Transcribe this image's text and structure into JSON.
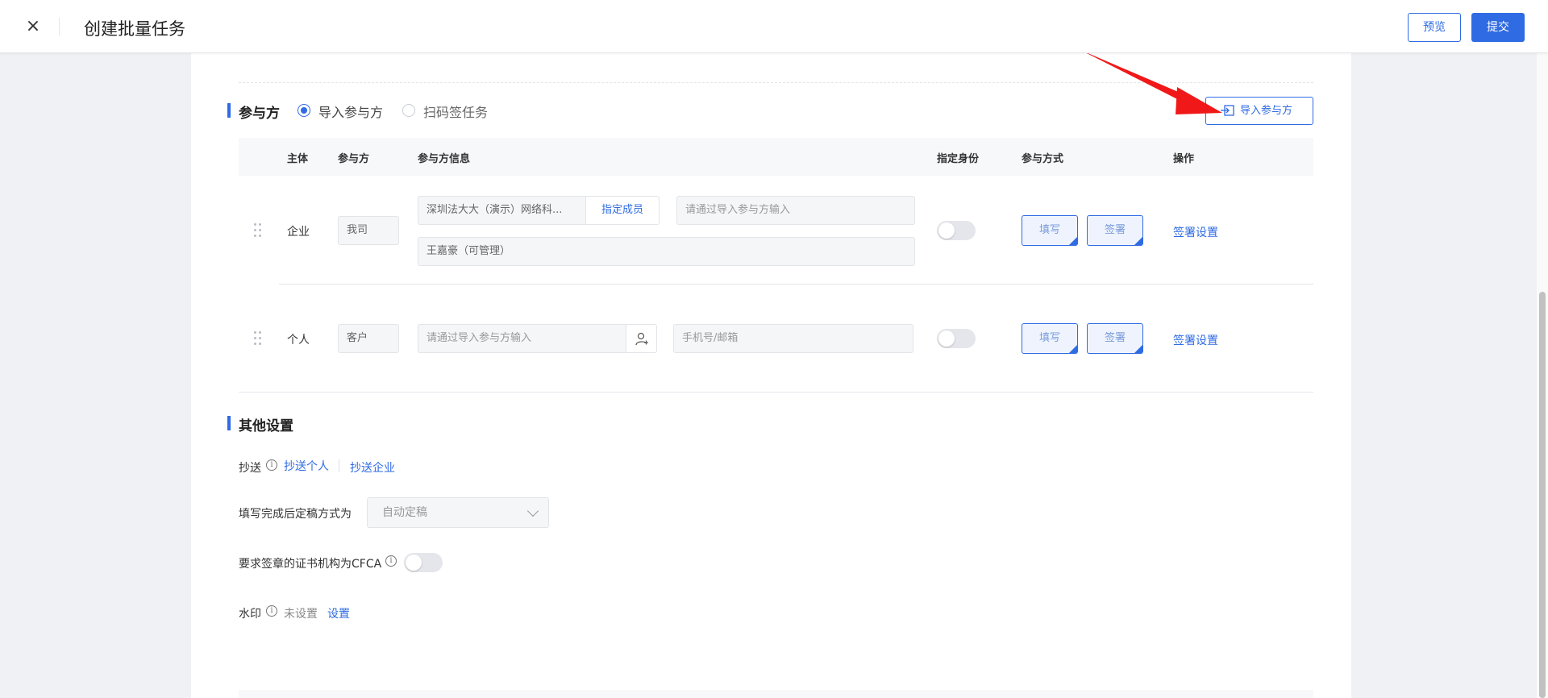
{
  "header": {
    "close_glyph": "×",
    "title": "创建批量任务",
    "preview_label": "预览",
    "submit_label": "提交"
  },
  "participants": {
    "section_title": "参与方",
    "mode_options": [
      {
        "label": "导入参与方",
        "selected": true
      },
      {
        "label": "扫码签任务",
        "selected": false
      }
    ],
    "import_button_label": "导入参与方",
    "columns": [
      "主体",
      "参与方",
      "参与方信息",
      "指定身份",
      "参与方式",
      "操作"
    ],
    "rows": [
      {
        "subject": "企业",
        "party": "我司",
        "info_company": "深圳法大大（演示）网络科...",
        "assign_member_label": "指定成员",
        "info_input_placeholder": "请通过导入参与方输入",
        "member": "王嘉豪（可管理）",
        "identity_toggle": false,
        "fill_label": "填写",
        "sign_label": "签署",
        "action_label": "签署设置"
      },
      {
        "subject": "个人",
        "party": "客户",
        "info_input_placeholder": "请通过导入参与方输入",
        "contact_placeholder": "手机号/邮箱",
        "identity_toggle": false,
        "fill_label": "填写",
        "sign_label": "签署",
        "action_label": "签署设置"
      }
    ]
  },
  "other_settings": {
    "section_title": "其他设置",
    "cc_label": "抄送",
    "cc_person_link": "抄送个人",
    "cc_company_link": "抄送企业",
    "finalize_label": "填写完成后定稿方式为",
    "finalize_value": "自动定稿",
    "cfca_label": "要求签章的证书机构为CFCA",
    "cfca_toggle": false,
    "watermark_label": "水印",
    "watermark_status": "未设置",
    "watermark_link": "设置"
  },
  "colors": {
    "accent": "#2f6be3",
    "annotation_arrow": "#f01818"
  }
}
